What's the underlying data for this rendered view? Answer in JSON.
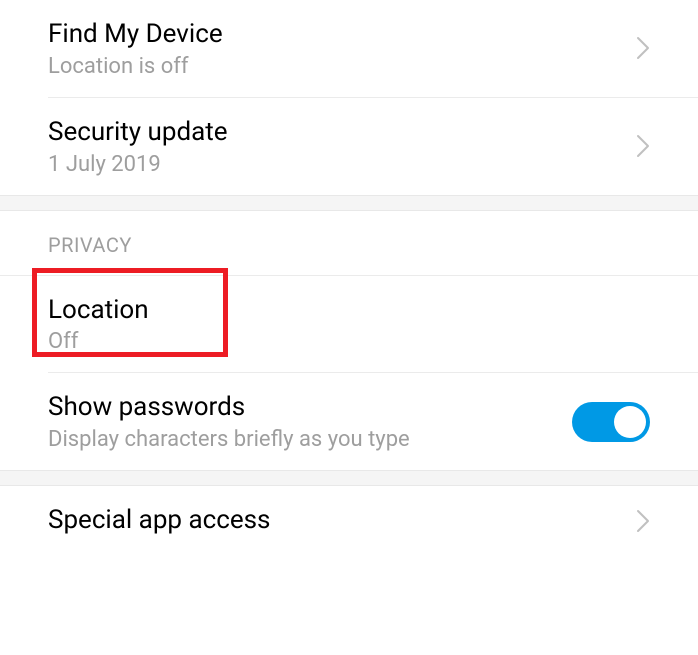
{
  "items": {
    "findMyDevice": {
      "title": "Find My Device",
      "subtitle": "Location is off"
    },
    "securityUpdate": {
      "title": "Security update",
      "subtitle": "1 July 2019"
    },
    "location": {
      "title": "Location",
      "subtitle": "Off"
    },
    "showPasswords": {
      "title": "Show passwords",
      "subtitle": "Display characters briefly as you type"
    },
    "specialAppAccess": {
      "title": "Special app access"
    }
  },
  "sections": {
    "privacy": "PRIVACY"
  }
}
